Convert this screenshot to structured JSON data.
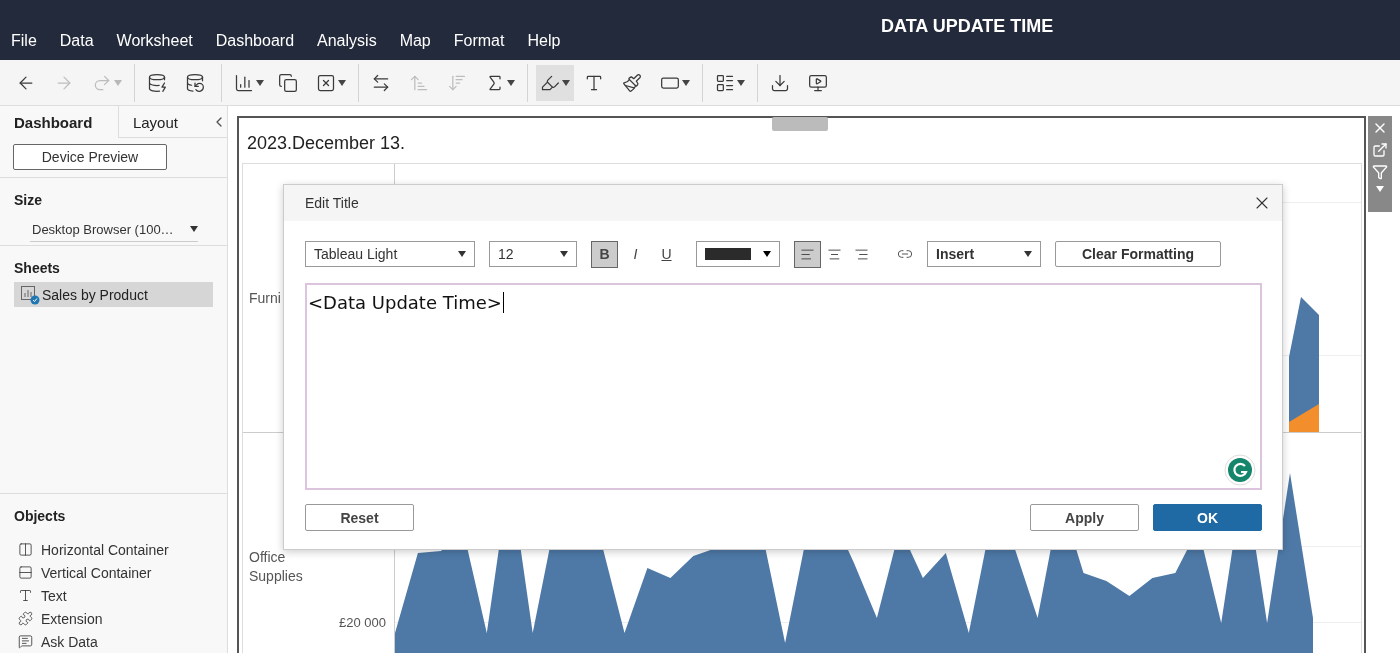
{
  "menu_bar": {
    "items": [
      "File",
      "Data",
      "Worksheet",
      "Dashboard",
      "Analysis",
      "Map",
      "Format",
      "Help"
    ],
    "banner": "DATA UPDATE TIME"
  },
  "toolbar": {
    "groups": [
      [
        {
          "kind": "back",
          "disabled": false,
          "caret": false
        },
        {
          "kind": "forward",
          "disabled": true,
          "caret": false
        },
        {
          "kind": "redo",
          "disabled": true,
          "caret": true
        }
      ],
      [
        {
          "kind": "new-datasource",
          "disabled": false,
          "caret": false
        },
        {
          "kind": "pause-updates",
          "disabled": false,
          "caret": false
        }
      ],
      [
        {
          "kind": "new-sheet",
          "disabled": false,
          "caret": true
        },
        {
          "kind": "duplicate",
          "disabled": false,
          "caret": false
        },
        {
          "kind": "clear",
          "disabled": false,
          "caret": true
        }
      ],
      [
        {
          "kind": "swap",
          "disabled": false,
          "caret": false
        },
        {
          "kind": "sort-asc",
          "disabled": true,
          "caret": false
        },
        {
          "kind": "sort-desc",
          "disabled": true,
          "caret": false
        },
        {
          "kind": "totals",
          "disabled": false,
          "caret": true
        }
      ],
      [
        {
          "kind": "highlight",
          "disabled": false,
          "caret": true,
          "selected": true
        },
        {
          "kind": "labels",
          "disabled": false,
          "caret": false,
          "selected": false
        },
        {
          "kind": "format",
          "disabled": false,
          "caret": false,
          "selected": false
        },
        {
          "kind": "fit",
          "disabled": false,
          "caret": true,
          "selected": false
        }
      ],
      [
        {
          "kind": "cards",
          "disabled": false,
          "caret": true
        }
      ],
      [
        {
          "kind": "download",
          "disabled": false,
          "caret": false
        },
        {
          "kind": "present",
          "disabled": false,
          "caret": false
        }
      ]
    ]
  },
  "sidebar": {
    "tabs": [
      {
        "label": "Dashboard",
        "selected": true
      },
      {
        "label": "Layout",
        "selected": false
      }
    ],
    "device_preview": "Device Preview",
    "size": {
      "heading": "Size",
      "value": "Desktop Browser (100…"
    },
    "sheets": {
      "heading": "Sheets",
      "items": [
        {
          "label": "Sales by Product",
          "selected": true
        }
      ]
    },
    "objects": {
      "heading": "Objects",
      "items": [
        {
          "kind": "horizontal",
          "label": "Horizontal Container"
        },
        {
          "kind": "vertical",
          "label": "Vertical Container"
        },
        {
          "kind": "text",
          "label": "Text"
        },
        {
          "kind": "extension",
          "label": "Extension"
        },
        {
          "kind": "ask",
          "label": "Ask Data"
        }
      ]
    }
  },
  "dashboard": {
    "title": "2023.December 13.",
    "rows": [
      {
        "label": "Furni"
      },
      {
        "label": "Office Supplies",
        "tick": "£20 000"
      }
    ]
  },
  "dialog": {
    "title": "Edit Title",
    "font": "Tableau Light",
    "size": "12",
    "styles": [
      {
        "kind": "bold",
        "label": "B",
        "selected": true
      },
      {
        "kind": "italic",
        "label": "I",
        "selected": false
      },
      {
        "kind": "underline",
        "label": "U",
        "selected": false
      }
    ],
    "alignments": [
      {
        "kind": "left",
        "selected": true
      },
      {
        "kind": "center",
        "selected": false
      },
      {
        "kind": "right",
        "selected": false
      }
    ],
    "insert": "Insert",
    "clear": "Clear Formatting",
    "value": "<Data Update Time>",
    "buttons": {
      "reset": "Reset",
      "apply": "Apply",
      "ok": "OK"
    }
  }
}
